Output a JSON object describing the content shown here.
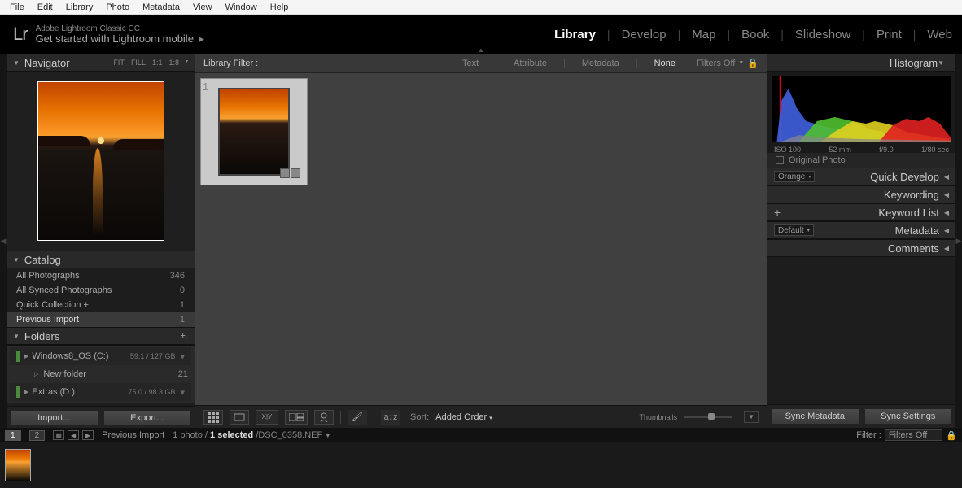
{
  "menubar": [
    "File",
    "Edit",
    "Library",
    "Photo",
    "Metadata",
    "View",
    "Window",
    "Help"
  ],
  "app": {
    "logo": "Lr",
    "title1": "Adobe Lightroom Classic CC",
    "title2": "Get started with Lightroom mobile"
  },
  "modules": {
    "items": [
      "Library",
      "Develop",
      "Map",
      "Book",
      "Slideshow",
      "Print",
      "Web"
    ],
    "active": "Library"
  },
  "navigator": {
    "label": "Navigator",
    "zoom": [
      "FIT",
      "FILL",
      "1:1",
      "1:8"
    ]
  },
  "catalog": {
    "label": "Catalog",
    "items": [
      {
        "label": "All Photographs",
        "count": "346"
      },
      {
        "label": "All Synced Photographs",
        "count": "0"
      },
      {
        "label": "Quick Collection  +",
        "count": "1"
      },
      {
        "label": "Previous Import",
        "count": "1",
        "selected": true
      }
    ]
  },
  "folders": {
    "label": "Folders",
    "drives": [
      {
        "name": "Windows8_OS (C:)",
        "cap": "59.1 / 127 GB",
        "subs": [
          {
            "name": "New folder",
            "count": "21"
          }
        ]
      },
      {
        "name": "Extras (D:)",
        "cap": "75.0 / 98.3 GB"
      }
    ]
  },
  "buttons": {
    "import": "Import...",
    "export": "Export...",
    "syncMeta": "Sync Metadata",
    "syncSet": "Sync Settings"
  },
  "libfilter": {
    "label": "Library Filter :",
    "opts": [
      "Text",
      "Attribute",
      "Metadata",
      "None"
    ],
    "selected": "None",
    "filtersOff": "Filters Off"
  },
  "grid": {
    "cellIndex": "1"
  },
  "toolbar": {
    "sortLabel": "Sort:",
    "sortValue": "Added Order",
    "sliderLabel": "Thumbnails"
  },
  "histogram": {
    "label": "Histogram",
    "meta": {
      "iso": "ISO 100",
      "focal": "52 mm",
      "aperture": "f/9.0",
      "shutter": "1/80 sec"
    },
    "orig": "Original Photo"
  },
  "rpanels": {
    "quickdev": {
      "label": "Quick Develop",
      "preset": "Orange"
    },
    "keywording": "Keywording",
    "keywordlist": "Keyword List",
    "metadata": {
      "label": "Metadata",
      "preset": "Default"
    },
    "comments": "Comments"
  },
  "status": {
    "pages": [
      "1",
      "2"
    ],
    "source": "Previous Import",
    "count": "1 photo /",
    "selected": "1 selected",
    "filename": "/DSC_0358.NEF",
    "filterLabel": "Filter :",
    "filterValue": "Filters Off"
  }
}
